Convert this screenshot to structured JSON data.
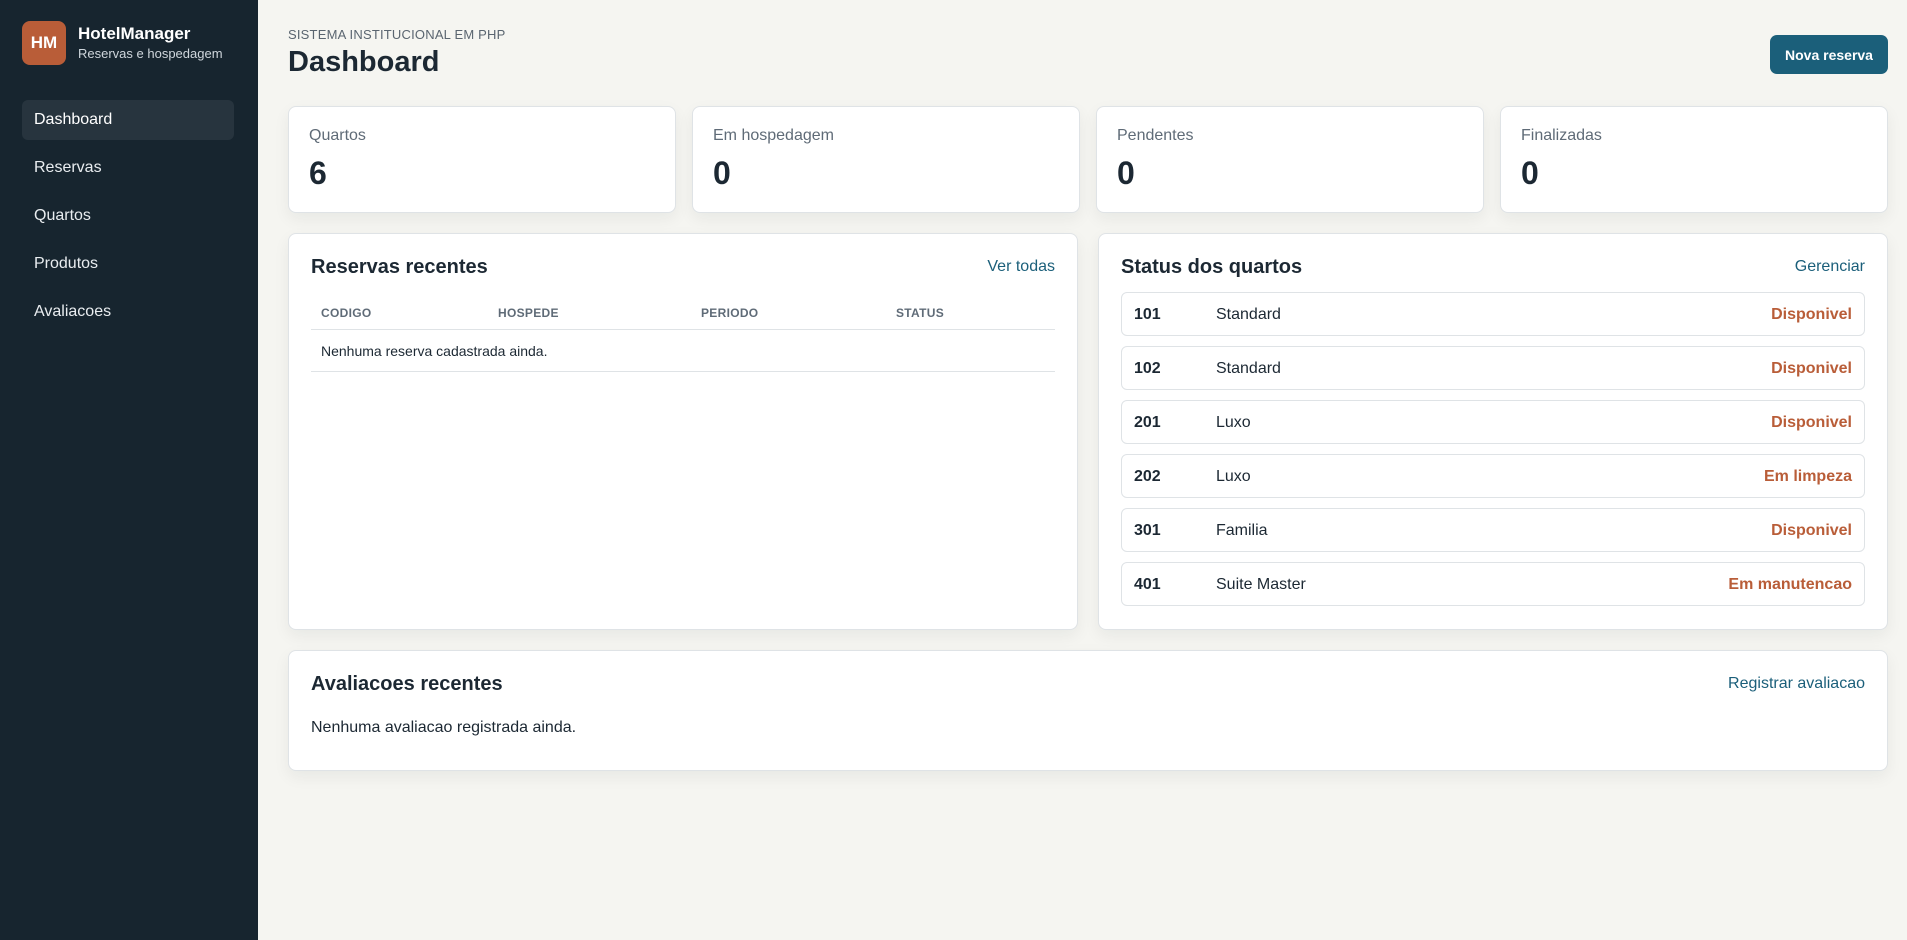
{
  "brand": {
    "logo": "HM",
    "name": "HotelManager",
    "subtitle": "Reservas e hospedagem"
  },
  "nav": {
    "items": [
      {
        "label": "Dashboard",
        "active": true
      },
      {
        "label": "Reservas"
      },
      {
        "label": "Quartos"
      },
      {
        "label": "Produtos"
      },
      {
        "label": "Avaliacoes"
      }
    ]
  },
  "header": {
    "eyebrow": "SISTEMA INSTITUCIONAL EM PHP",
    "title": "Dashboard",
    "primary_button": "Nova reserva"
  },
  "stats": [
    {
      "label": "Quartos",
      "value": "6"
    },
    {
      "label": "Em hospedagem",
      "value": "0"
    },
    {
      "label": "Pendentes",
      "value": "0"
    },
    {
      "label": "Finalizadas",
      "value": "0"
    }
  ],
  "recent_reservations": {
    "title": "Reservas recentes",
    "link": "Ver todas",
    "columns": [
      "CODIGO",
      "HOSPEDE",
      "PERIODO",
      "STATUS"
    ],
    "empty": "Nenhuma reserva cadastrada ainda."
  },
  "room_status": {
    "title": "Status dos quartos",
    "link": "Gerenciar",
    "rooms": [
      {
        "number": "101",
        "type": "Standard",
        "status": "Disponivel"
      },
      {
        "number": "102",
        "type": "Standard",
        "status": "Disponivel"
      },
      {
        "number": "201",
        "type": "Luxo",
        "status": "Disponivel"
      },
      {
        "number": "202",
        "type": "Luxo",
        "status": "Em limpeza"
      },
      {
        "number": "301",
        "type": "Familia",
        "status": "Disponivel"
      },
      {
        "number": "401",
        "type": "Suite Master",
        "status": "Em manutencao"
      }
    ]
  },
  "reviews": {
    "title": "Avaliacoes recentes",
    "link": "Registrar avaliacao",
    "empty": "Nenhuma avaliacao registrada ainda."
  },
  "colors": {
    "sidebar": "#17252f",
    "accent": "#1b5f7a",
    "status": "#b95d38",
    "background": "#f5f5f1"
  }
}
